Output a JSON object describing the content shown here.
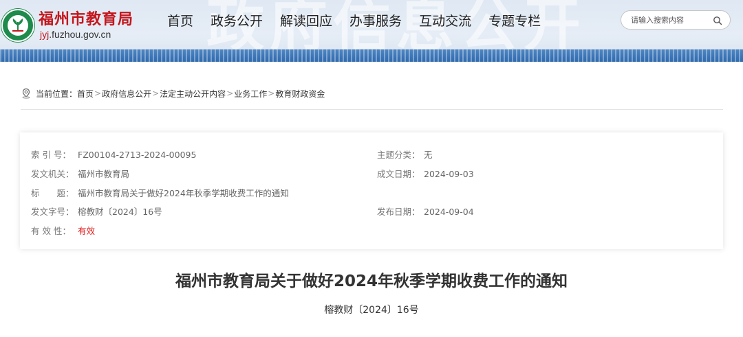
{
  "header": {
    "bg_text": "政府信息公开",
    "site_title": "福州市教育局",
    "domain_highlight": "jyj",
    "domain_rest": ".fuzhou.gov.cn",
    "accent_color": "#c4161c",
    "nav": [
      {
        "label": "首页"
      },
      {
        "label": "政务公开"
      },
      {
        "label": "解读回应"
      },
      {
        "label": "办事服务"
      },
      {
        "label": "互动交流"
      },
      {
        "label": "专题专栏"
      }
    ],
    "search": {
      "placeholder": "请输入搜索内容",
      "icon": "search-icon"
    }
  },
  "breadcrumb": {
    "icon": "location-icon",
    "prefix": "当前位置：",
    "items": [
      "首页",
      "政府信息公开",
      "法定主动公开内容",
      "业务工作",
      "教育财政资金"
    ],
    "separator": ">"
  },
  "info": {
    "index_label": "索 引 号：",
    "index_value": "FZ00104-2713-2024-00095",
    "topic_label": "主题分类：",
    "topic_value": "无",
    "issuer_label": "发文机关：",
    "issuer_value": "福州市教育局",
    "written_label": "成文日期：",
    "written_value": "2024-09-03",
    "title_label": "标　　题：",
    "title_value": "福州市教育局关于做好2024年秋季学期收费工作的通知",
    "docno_label": "发文字号：",
    "docno_value": "榕教财〔2024〕16号",
    "published_label": "发布日期：",
    "published_value": "2024-09-04",
    "validity_label": "有 效 性：",
    "validity_value": "有效",
    "validity_color": "#e31b1b"
  },
  "article": {
    "title": "福州市教育局关于做好2024年秋季学期收费工作的通知",
    "doc_number": "榕教财〔2024〕16号"
  }
}
